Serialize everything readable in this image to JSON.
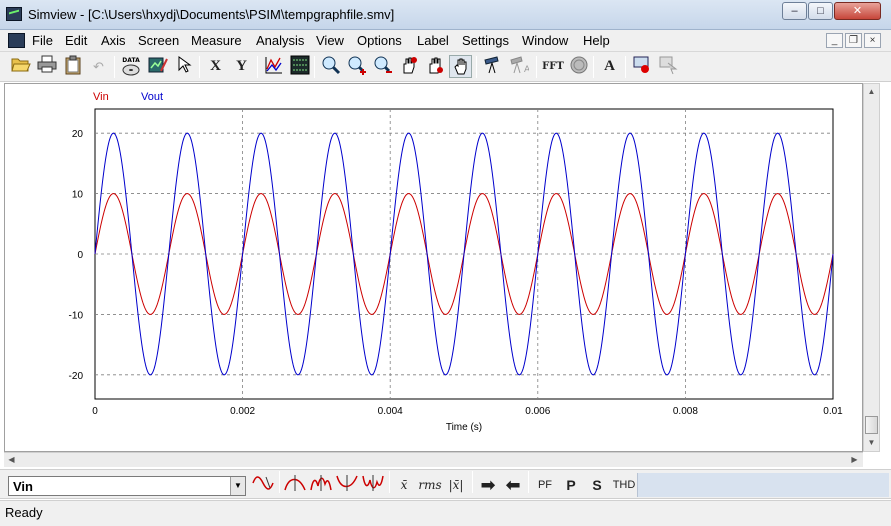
{
  "window": {
    "title": "Simview - [C:\\Users\\hxydj\\Documents\\PSIM\\tempgraphfile.smv]",
    "minimize_label": "–",
    "maximize_label": "□",
    "close_label": "✕"
  },
  "menu": {
    "items": [
      "File",
      "Edit",
      "Axis",
      "Screen",
      "Measure",
      "Analysis",
      "View",
      "Options",
      "Label",
      "Settings",
      "Window",
      "Help"
    ]
  },
  "toolbar": {
    "icons": [
      "open-icon",
      "print-icon",
      "clipboard-icon",
      "undo-icon",
      "data-icon",
      "edit-curve-icon",
      "pointer-icon",
      "x-axis-icon",
      "y-axis-icon",
      "graph-icon",
      "grid-icon",
      "zoom-icon",
      "zoom-in-icon",
      "zoom-out-icon",
      "max-hand-icon",
      "min-hand-icon",
      "pan-hand-icon",
      "telescope-icon",
      "marker-icon",
      "fft-icon",
      "fill-icon",
      "text-icon",
      "label-icon",
      "copy-icon"
    ],
    "x_label": "X",
    "y_label": "Y",
    "data_label": "DATA",
    "fft_label": "FFT",
    "text_label": "A"
  },
  "bottom": {
    "selected_curve": "Vin",
    "mean_label": "x̄",
    "rms_label": "rms",
    "abs_mean_label": "|x̄|",
    "pf_label": "PF",
    "p_label": "P",
    "s_label": "S",
    "thd_label": "THD"
  },
  "status": {
    "text": "Ready"
  },
  "colors": {
    "vin": "#cc0000",
    "vout": "#0000cc",
    "grid": "#808080"
  },
  "chart_data": {
    "type": "line",
    "title": "",
    "xlabel": "Time (s)",
    "ylabel": "",
    "xlim": [
      0,
      0.01
    ],
    "ylim": [
      -24,
      24
    ],
    "x_ticks": [
      0,
      0.002,
      0.004,
      0.006,
      0.008,
      0.01
    ],
    "x_tick_labels": [
      "0",
      "0.002",
      "0.004",
      "0.006",
      "0.008",
      "0.01"
    ],
    "y_ticks": [
      -20,
      -10,
      0,
      10,
      20
    ],
    "y_tick_labels": [
      "-20",
      "-10",
      "0",
      "10",
      "20"
    ],
    "grid": true,
    "legend": "top-left",
    "series": [
      {
        "name": "Vin",
        "color": "#cc0000",
        "waveform": "sine",
        "amplitude": 10,
        "frequency_hz": 1000,
        "phase_deg": 0,
        "x_start": 0,
        "x_end": 0.01
      },
      {
        "name": "Vout",
        "color": "#0000cc",
        "waveform": "sine",
        "amplitude": 20,
        "frequency_hz": 1000,
        "phase_deg": 0,
        "x_start": 0,
        "x_end": 0.01
      }
    ]
  }
}
